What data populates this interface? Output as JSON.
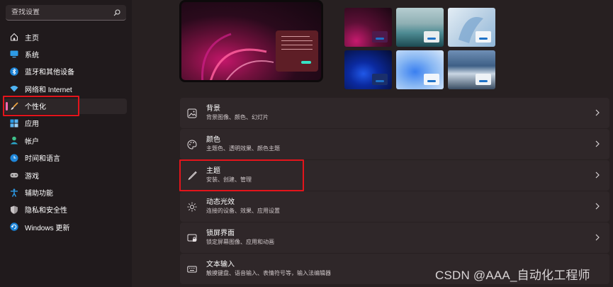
{
  "search": {
    "placeholder": "查找设置"
  },
  "sidebar": {
    "items": [
      {
        "label": "主页",
        "icon": "home-icon"
      },
      {
        "label": "系统",
        "icon": "monitor-icon"
      },
      {
        "label": "蓝牙和其他设备",
        "icon": "bluetooth-icon"
      },
      {
        "label": "网络和 Internet",
        "icon": "wifi-icon"
      },
      {
        "label": "个性化",
        "icon": "brush-icon",
        "selected": true
      },
      {
        "label": "应用",
        "icon": "apps-icon"
      },
      {
        "label": "帐户",
        "icon": "account-icon"
      },
      {
        "label": "时间和语言",
        "icon": "globe-clock-icon"
      },
      {
        "label": "游戏",
        "icon": "gamepad-icon"
      },
      {
        "label": "辅助功能",
        "icon": "accessibility-icon"
      },
      {
        "label": "隐私和安全性",
        "icon": "shield-icon"
      },
      {
        "label": "Windows 更新",
        "icon": "update-icon"
      }
    ]
  },
  "settings": [
    {
      "title": "背景",
      "desc": "背景图像、颜色、幻灯片",
      "icon": "image-icon"
    },
    {
      "title": "颜色",
      "desc": "主题色、透明效果、颜色主题",
      "icon": "palette-icon"
    },
    {
      "title": "主题",
      "desc": "安装、创建、管理",
      "icon": "pen-icon"
    },
    {
      "title": "动态光效",
      "desc": "连接的设备、效果、应用设置",
      "icon": "light-effect-icon"
    },
    {
      "title": "锁屏界面",
      "desc": "锁定屏幕图像、应用和动画",
      "icon": "lock-screen-icon"
    },
    {
      "title": "文本输入",
      "desc": "触摸键盘、语音输入、表情符号等，输入法编辑器",
      "icon": "keyboard-icon"
    }
  ],
  "colors": {
    "accent": "#ff6ab0",
    "annotation_box": "#e3141b",
    "background": "#272021",
    "card": "#2f2729"
  },
  "watermark": "CSDN @AAA_自动化工程师"
}
